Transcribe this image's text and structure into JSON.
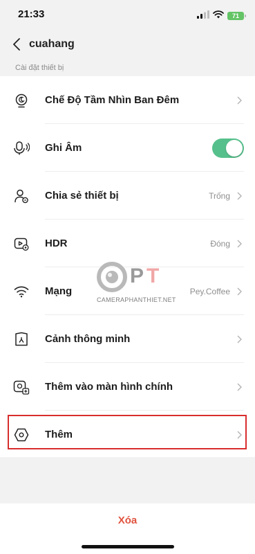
{
  "status_bar": {
    "time": "21:33",
    "battery": "71"
  },
  "nav": {
    "title": "cuahang"
  },
  "section_label": "Cài đặt thiết bị",
  "items": [
    {
      "label": "Chế Độ Tầm Nhìn Ban Đêm",
      "value": "",
      "icon": "night-vision-icon"
    },
    {
      "label": "Ghi Âm",
      "value": "",
      "icon": "microphone-icon",
      "toggle_on": true
    },
    {
      "label": "Chia sẻ thiết bị",
      "value": "Trống",
      "icon": "share-user-icon"
    },
    {
      "label": "HDR",
      "value": "Đóng",
      "icon": "hdr-camera-icon"
    },
    {
      "label": "Mạng",
      "value": "Pey.Coffee",
      "icon": "wifi-icon"
    },
    {
      "label": "Cảnh thông minh",
      "value": "",
      "icon": "smart-scene-icon"
    },
    {
      "label": "Thêm vào màn hình chính",
      "value": "",
      "icon": "add-to-home-icon"
    },
    {
      "label": "Thêm",
      "value": "",
      "icon": "more-hex-icon"
    }
  ],
  "delete_label": "Xóa",
  "watermark": {
    "letters_p": "P",
    "letters_t": "T",
    "text": "CAMERAPHANTHIET.NET"
  },
  "colors": {
    "toggle_on": "#56c08c",
    "delete": "#e0533f",
    "highlight": "#d82c2c"
  }
}
